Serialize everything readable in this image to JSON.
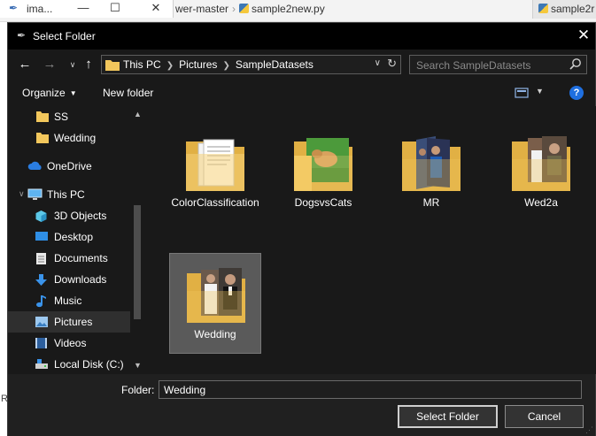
{
  "background": {
    "window_title": "ima...",
    "breadcrumb_tail": "wer-master",
    "file_name": "sample2new.py",
    "right_tab_label": "sample2r",
    "left_edge_chars": [
      "R",
      "G"
    ]
  },
  "dialog": {
    "title": "Select Folder",
    "address": {
      "crumbs": [
        "This PC",
        "Pictures",
        "SampleDatasets"
      ]
    },
    "search": {
      "placeholder": "Search SampleDatasets"
    },
    "toolbar": {
      "organize": "Organize",
      "new_folder": "New folder",
      "help": "?"
    },
    "nav_items": [
      {
        "label": "SS",
        "icon": "folder-icon",
        "selected": false
      },
      {
        "label": "Wedding",
        "icon": "folder-icon",
        "selected": false
      },
      {
        "label": "OneDrive",
        "icon": "cloud-icon",
        "selected": false
      },
      {
        "label": "This PC",
        "icon": "computer-icon",
        "selected": false
      },
      {
        "label": "3D Objects",
        "icon": "cube-icon",
        "selected": false
      },
      {
        "label": "Desktop",
        "icon": "desktop-icon",
        "selected": false
      },
      {
        "label": "Documents",
        "icon": "documents-icon",
        "selected": false
      },
      {
        "label": "Downloads",
        "icon": "download-icon",
        "selected": false
      },
      {
        "label": "Music",
        "icon": "music-icon",
        "selected": false
      },
      {
        "label": "Pictures",
        "icon": "pictures-icon",
        "selected": true
      },
      {
        "label": "Videos",
        "icon": "videos-icon",
        "selected": false
      },
      {
        "label": "Local Disk (C:)",
        "icon": "disk-icon",
        "selected": false
      }
    ],
    "folders": [
      {
        "label": "ColorClassification",
        "thumbnail": "documents",
        "selected": false
      },
      {
        "label": "DogsvsCats",
        "thumbnail": "dog-photo",
        "selected": false
      },
      {
        "label": "MR",
        "thumbnail": "people-photos",
        "selected": false
      },
      {
        "label": "Wed2a",
        "thumbnail": "wedding-photos",
        "selected": false
      },
      {
        "label": "Wedding",
        "thumbnail": "wedding-photos",
        "selected": true
      }
    ],
    "folder_field": {
      "label": "Folder:",
      "value": "Wedding"
    },
    "buttons": {
      "select": "Select Folder",
      "cancel": "Cancel"
    },
    "colors": {
      "dialog_bg": "#191919",
      "selection": "#5a5a5a",
      "accent": "#1f6fe0",
      "folder": "#f2c75c"
    }
  }
}
